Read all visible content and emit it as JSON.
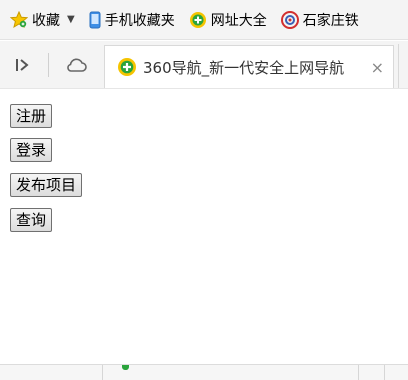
{
  "bookmarks_bar": {
    "items": [
      {
        "label": "收藏",
        "icon": "star-icon"
      },
      {
        "label": "手机收藏夹",
        "icon": "phone-icon"
      },
      {
        "label": "网址大全",
        "icon": "navigation-logo-icon"
      },
      {
        "label": "石家庄铁",
        "icon": "site-logo-icon"
      }
    ]
  },
  "tabs": [
    {
      "title": "360导航_新一代安全上网导航",
      "icon": "360-logo-icon",
      "close": "×"
    }
  ],
  "page": {
    "buttons": [
      {
        "label": "注册"
      },
      {
        "label": "登录"
      },
      {
        "label": "发布项目"
      },
      {
        "label": "查询"
      }
    ]
  },
  "colors": {
    "accent_green": "#2aa43c",
    "accent_yellow": "#f5c400",
    "site_red": "#d22f2f"
  }
}
